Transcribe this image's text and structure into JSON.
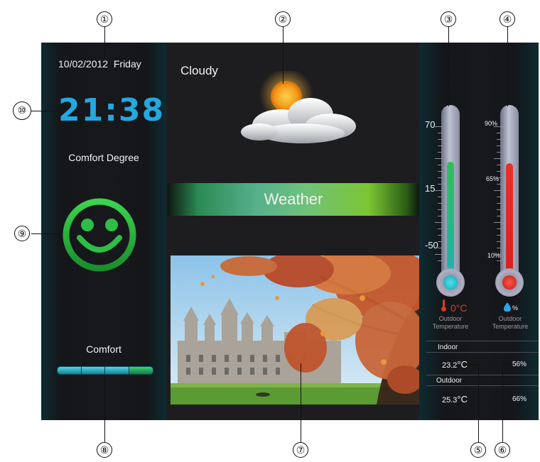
{
  "header": {
    "date": "10/02/2012",
    "weekday": "Friday",
    "time": "21:38"
  },
  "comfort": {
    "title": "Comfort Degree",
    "status": "Comfort",
    "face_icon": "smiley-face-icon",
    "color": "#2fb84a"
  },
  "weather": {
    "condition": "Cloudy",
    "banner_label": "Weather",
    "icon": "cloud-sun-icon"
  },
  "photo": {
    "description_icon": "chateau-autumn-photo"
  },
  "thermometer_temp": {
    "scale": [
      "70",
      "15",
      "-50"
    ],
    "unit": "0°C",
    "caption_line1": "Outdoor",
    "caption_line2": "Temperature",
    "fill_color": "#2fbf5a",
    "level": 0.58
  },
  "thermometer_humidity": {
    "scale": [
      "90%",
      "65%",
      "10%"
    ],
    "unit": "%",
    "caption_line1": "Outdoor",
    "caption_line2": "Temperature",
    "fill_color": "#e8302c",
    "level": 0.6
  },
  "readings": {
    "indoor_label": "Indoor",
    "indoor_temp": "23.2",
    "indoor_temp_unit": "°C",
    "indoor_humidity": "56%",
    "outdoor_label": "Outdoor",
    "outdoor_temp": "25.3",
    "outdoor_temp_unit": "°C",
    "outdoor_humidity": "66%"
  },
  "callouts": [
    "①",
    "②",
    "③",
    "④",
    "⑤",
    "⑥",
    "⑦",
    "⑧",
    "⑨",
    "⑩"
  ]
}
